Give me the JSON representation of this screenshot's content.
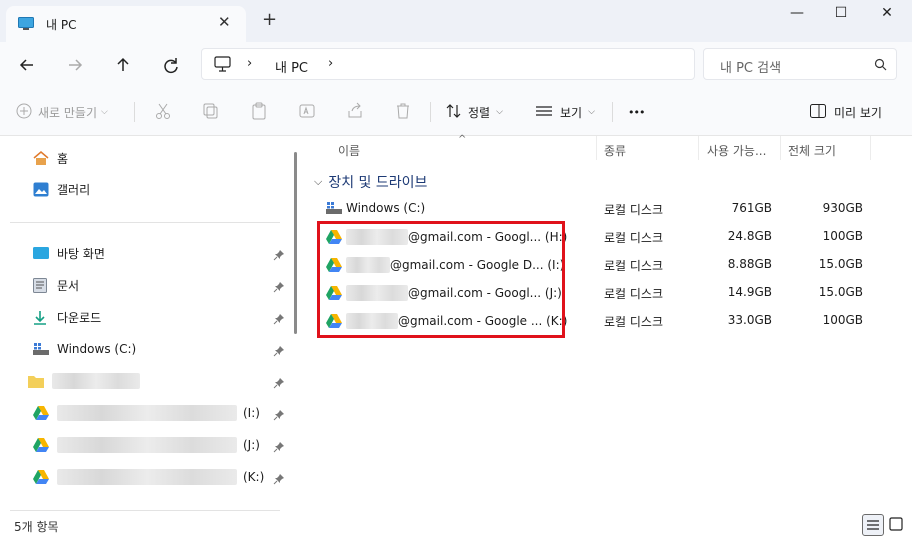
{
  "window": {
    "tab_title": "내 PC",
    "new_tab": "+",
    "close_tab": "✕",
    "minimize": "—",
    "maximize": "☐",
    "close": "✕"
  },
  "nav": {
    "breadcrumb_root": "내 PC",
    "search_placeholder": "내 PC 검색"
  },
  "toolbar": {
    "new_label": "새로 만들기",
    "sort_label": "정렬",
    "view_label": "보기",
    "more_label": "•••",
    "preview_label": "미리 보기"
  },
  "sidebar": {
    "quick": [
      {
        "label": "홈",
        "icon": "home-icon"
      },
      {
        "label": "갤러리",
        "icon": "gallery-icon"
      }
    ],
    "pinned": [
      {
        "label": "바탕 화면",
        "icon": "desktop-icon"
      },
      {
        "label": "문서",
        "icon": "document-icon"
      },
      {
        "label": "다운로드",
        "icon": "download-icon"
      },
      {
        "label": "Windows (C:)",
        "icon": "drive-icon"
      }
    ],
    "gdrives": [
      {
        "label": "(I:)"
      },
      {
        "label": "(J:)"
      },
      {
        "label": "(K:)"
      }
    ]
  },
  "columns": {
    "name": "이름",
    "type": "종류",
    "free": "사용 가능...",
    "total": "전체 크기"
  },
  "group": {
    "label": "장치 및 드라이브"
  },
  "drives": [
    {
      "name": "Windows (C:)",
      "type": "로컬 디스크",
      "free": "761GB",
      "total": "930GB",
      "icon": "windows-drive-icon"
    },
    {
      "name": "@gmail.com - Googl...  (H:)",
      "type": "로컬 디스크",
      "free": "24.8GB",
      "total": "100GB",
      "icon": "google-drive-icon"
    },
    {
      "name": "@gmail.com - Google D...  (I:)",
      "type": "로컬 디스크",
      "free": "8.88GB",
      "total": "15.0GB",
      "icon": "google-drive-icon"
    },
    {
      "name": "@gmail.com - Googl...  (J:)",
      "type": "로컬 디스크",
      "free": "14.9GB",
      "total": "15.0GB",
      "icon": "google-drive-icon"
    },
    {
      "name": "@gmail.com - Google ...  (K:)",
      "type": "로컬 디스크",
      "free": "33.0GB",
      "total": "100GB",
      "icon": "google-drive-icon"
    }
  ],
  "status": {
    "item_count": "5개 항목"
  },
  "colors": {
    "accent": "#0067c0",
    "highlight_border": "#e0121b",
    "group_text": "#1d3a75"
  }
}
